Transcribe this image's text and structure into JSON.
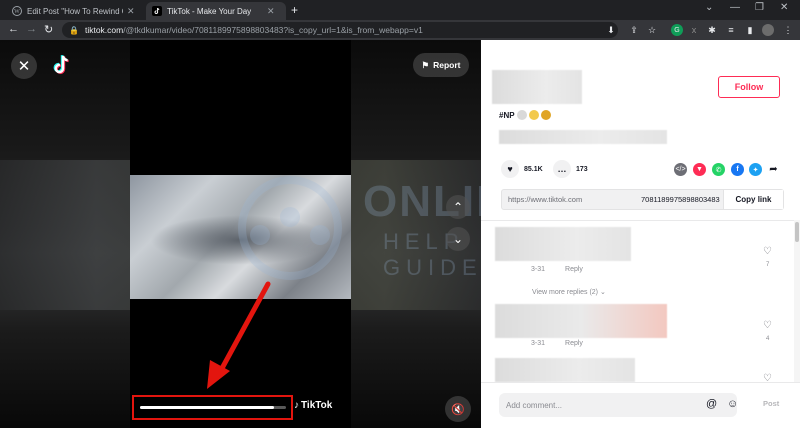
{
  "browser": {
    "tabs": [
      {
        "title": "Edit Post \"How To Rewind Or Fast",
        "active": false
      },
      {
        "title": "TikTok - Make Your Day",
        "active": true
      }
    ],
    "url_host": "tiktok.com",
    "url_path": "/@tkdkumar/video/7081189975898803483?is_copy_url=1&is_from_webapp=v1",
    "new_tab": "+",
    "window_controls": [
      "⌄",
      "—",
      "❐",
      "✕"
    ]
  },
  "video": {
    "report_label": "Report",
    "progress": 0.92,
    "tiktok_watermark": "TikTok",
    "site_watermark_line1": "ONLINE",
    "site_watermark_line2": "HELP GUIDE"
  },
  "panel": {
    "follow_label": "Follow",
    "hashtag": "#NP",
    "likes": "85.1K",
    "comments": "173",
    "share_url": "https://www.tiktok.com",
    "share_video_id": "7081189975898803483",
    "copy_link_label": "Copy link",
    "comment_list": [
      {
        "date": "3-31",
        "reply": "Reply",
        "likes": "7"
      },
      {
        "date": "3-31",
        "reply": "Reply",
        "likes": "4"
      },
      {
        "date": "",
        "reply": "",
        "likes": ""
      }
    ],
    "view_more_replies": "View more replies (2)",
    "comment_placeholder": "Add comment...",
    "post_label": "Post"
  },
  "colors": {
    "accent": "#fe2c55",
    "annotation_red": "#e3150e",
    "chrome_dark": "#202124",
    "chrome_mid": "#35363a"
  },
  "icons": {
    "close": "close-icon",
    "report": "flag-icon",
    "up": "chevron-up-icon",
    "down": "chevron-down-icon",
    "mute": "mute-icon",
    "heart": "heart-icon",
    "comment": "comment-icon",
    "embed": "embed-icon",
    "whatsapp": "whatsapp-icon",
    "facebook": "facebook-icon",
    "twitter": "twitter-icon",
    "forward": "share-arrow-icon",
    "at": "at-icon",
    "emoji": "emoji-icon"
  }
}
